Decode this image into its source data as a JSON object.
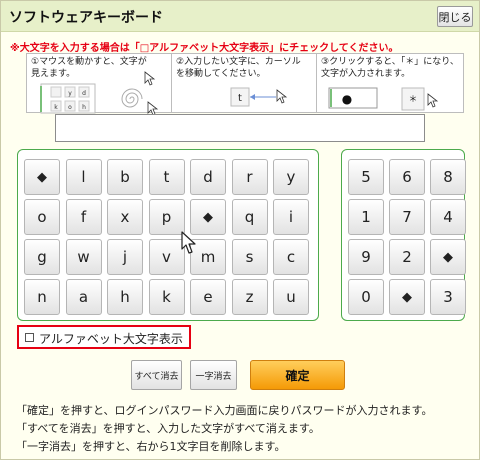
{
  "window": {
    "title": "ソフトウェアキーボード",
    "close_label": "閉じる"
  },
  "warning": "※大文字を入力する場合は「□アルファベット大文字表示」にチェックしてください。",
  "steps": [
    {
      "text": "①マウスを動かすと、文字が見えます。",
      "keys": [
        "y",
        "d",
        "k",
        "o",
        "h"
      ]
    },
    {
      "text": "②入力したい文字に、カーソルを移動してください。",
      "key": "t"
    },
    {
      "text": "③クリックすると、「＊」になり、文字が入力されます。",
      "masked": "●",
      "key": "＊"
    }
  ],
  "letter_rows": [
    [
      "◆",
      "l",
      "b",
      "t",
      "d",
      "r",
      "y"
    ],
    [
      "o",
      "f",
      "x",
      "p",
      "◆",
      "q",
      "i"
    ],
    [
      "g",
      "w",
      "j",
      "v",
      "m",
      "s",
      "c"
    ],
    [
      "n",
      "a",
      "h",
      "k",
      "e",
      "z",
      "u"
    ]
  ],
  "digit_rows": [
    [
      "5",
      "6",
      "8"
    ],
    [
      "1",
      "7",
      "4"
    ],
    [
      "9",
      "2",
      "◆"
    ],
    [
      "0",
      "◆",
      "3"
    ]
  ],
  "caps_label": "アルファベット大文字表示",
  "actions": {
    "clear_all": "すべて消去",
    "delete_one": "一字消去",
    "confirm": "確定"
  },
  "notes": [
    "「確定」を押すと、ログインパスワード入力画面に戻りパスワードが入力されます。",
    "「すべてを消去」を押すと、入力した文字がすべて消えます。",
    "「一字消去」を押すと、右から1文字目を削除します。"
  ],
  "colors": {
    "title_bar": "#e7f0c9",
    "warning": "#e60012",
    "panel_border": "#4caa4c",
    "confirm_button": "#f59a06"
  }
}
